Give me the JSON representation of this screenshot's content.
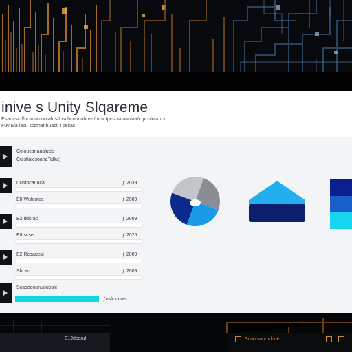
{
  "header": {
    "title": "inive  s  Unity  Slqareme",
    "subtitle": "Esaucsc f/ncvcamuotalus/loschcoucobuss/onsctpcsoscaaulaa/ctpculosrucr",
    "subtitle2": "Fuv Ela lacu scctnanhuaclr l ceitas"
  },
  "list_header": {
    "line1": "Coloucanaualucis",
    "line2": "CulstlalcsoanaTallut)"
  },
  "rows": [
    {
      "label": "Custocauuca",
      "value": "ƒ 2039",
      "progress": null
    },
    {
      "label": "E8 Wufcutoe",
      "value": "ƒ 2009",
      "progress": null
    },
    {
      "label": "E2 Ildsrac",
      "value": "ƒ 2009",
      "progress": null
    },
    {
      "label": "E8 scse",
      "value": "ƒ 2025",
      "progress": null
    },
    {
      "label": "E2 Rcoaucal",
      "value": "ƒ 2009",
      "progress": null
    },
    {
      "label": "Shcau",
      "value": "ƒ 2009",
      "progress": null
    },
    {
      "label": "Scaodcoanuouoslc",
      "value": "ƒuslc ccuts",
      "progress": 1.0
    }
  ],
  "charts": {
    "pie": {
      "slices": [
        {
          "value": 25,
          "color": "#8a8e94"
        },
        {
          "value": 25,
          "color": "#1a9be8"
        },
        {
          "value": 25,
          "color": "#0b2a8c"
        },
        {
          "value": 25,
          "color": "#c2c6cb"
        }
      ]
    },
    "triangle_color": "#23aef0",
    "triangle_base_color": "#0b1f6e",
    "bar_colors": [
      "#0b1f8e",
      "#1a5fc9",
      "#15d6ec"
    ]
  },
  "footer": {
    "left_label": "E1Jdcarul",
    "right_label": "Scuo sonrudcoe"
  }
}
